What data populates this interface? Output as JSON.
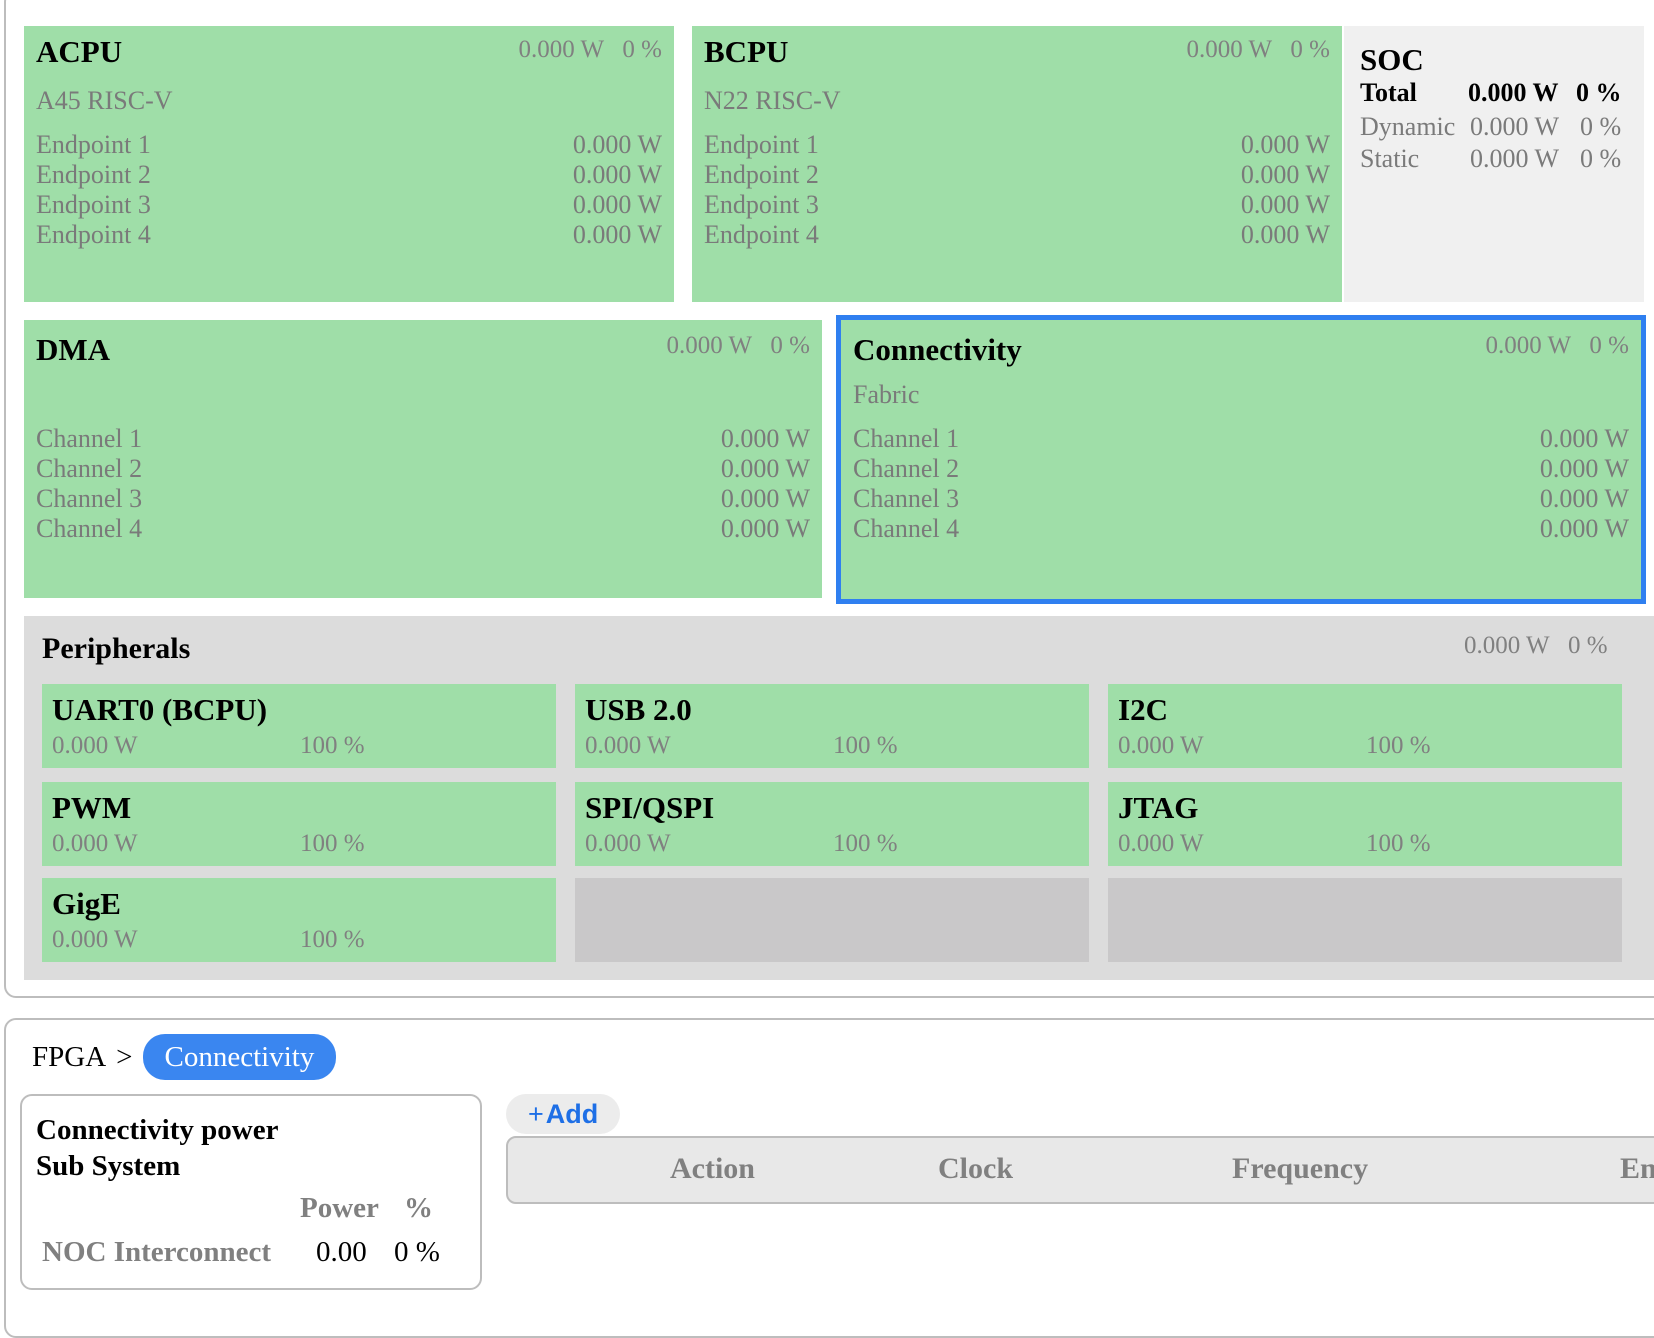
{
  "soc": {
    "title": "SOC",
    "total_label": "Total",
    "total_power": "0.000 W",
    "total_pct": "0 %",
    "dynamic_label": "Dynamic",
    "dynamic_power": "0.000 W",
    "dynamic_pct": "0 %",
    "static_label": "Static",
    "static_power": "0.000 W",
    "static_pct": "0 %"
  },
  "acpu": {
    "title": "ACPU",
    "power": "0.000 W",
    "pct": "0 %",
    "subtitle": "A45 RISC-V",
    "rows": [
      {
        "label": "Endpoint 1",
        "value": "0.000 W"
      },
      {
        "label": "Endpoint 2",
        "value": "0.000 W"
      },
      {
        "label": "Endpoint 3",
        "value": "0.000 W"
      },
      {
        "label": "Endpoint 4",
        "value": "0.000 W"
      }
    ]
  },
  "bcpu": {
    "title": "BCPU",
    "power": "0.000 W",
    "pct": "0 %",
    "subtitle": "N22 RISC-V",
    "rows": [
      {
        "label": "Endpoint 1",
        "value": "0.000 W"
      },
      {
        "label": "Endpoint 2",
        "value": "0.000 W"
      },
      {
        "label": "Endpoint 3",
        "value": "0.000 W"
      },
      {
        "label": "Endpoint 4",
        "value": "0.000 W"
      }
    ]
  },
  "dma": {
    "title": "DMA",
    "power": "0.000 W",
    "pct": "0 %",
    "rows": [
      {
        "label": "Channel 1",
        "value": "0.000 W"
      },
      {
        "label": "Channel 2",
        "value": "0.000 W"
      },
      {
        "label": "Channel 3",
        "value": "0.000 W"
      },
      {
        "label": "Channel 4",
        "value": "0.000 W"
      }
    ]
  },
  "connectivity": {
    "title": "Connectivity",
    "power": "0.000 W",
    "pct": "0 %",
    "subtitle": "Fabric",
    "rows": [
      {
        "label": "Channel 1",
        "value": "0.000 W"
      },
      {
        "label": "Channel 2",
        "value": "0.000 W"
      },
      {
        "label": "Channel 3",
        "value": "0.000 W"
      },
      {
        "label": "Channel 4",
        "value": "0.000 W"
      }
    ]
  },
  "peripherals": {
    "title": "Peripherals",
    "power": "0.000 W",
    "pct": "0 %",
    "items": [
      {
        "name": "UART0 (BCPU)",
        "power": "0.000 W",
        "pct": "100 %"
      },
      {
        "name": "USB 2.0",
        "power": "0.000 W",
        "pct": "100 %"
      },
      {
        "name": "I2C",
        "power": "0.000 W",
        "pct": "100 %"
      },
      {
        "name": "PWM",
        "power": "0.000 W",
        "pct": "100 %"
      },
      {
        "name": "SPI/QSPI",
        "power": "0.000 W",
        "pct": "100 %"
      },
      {
        "name": "JTAG",
        "power": "0.000 W",
        "pct": "100 %"
      },
      {
        "name": "GigE",
        "power": "0.000 W",
        "pct": "100 %"
      }
    ]
  },
  "breadcrumb": {
    "root": "FPGA",
    "separator": ">",
    "current": "Connectivity"
  },
  "summary_card": {
    "title_line1": "Connectivity power",
    "title_line2": "Sub System",
    "col_power": "Power",
    "col_pct": "%",
    "row_label": "NOC Interconnect",
    "row_power": "0.00",
    "row_pct": "0 %"
  },
  "add_button": {
    "plus": "+",
    "label": "Add"
  },
  "table": {
    "headers": [
      "Action",
      "Clock",
      "Frequency",
      "En"
    ]
  },
  "colors": {
    "block_green": "#9fdea8",
    "selected_border": "#2f7ff0",
    "accent_blue": "#3a86f0"
  }
}
